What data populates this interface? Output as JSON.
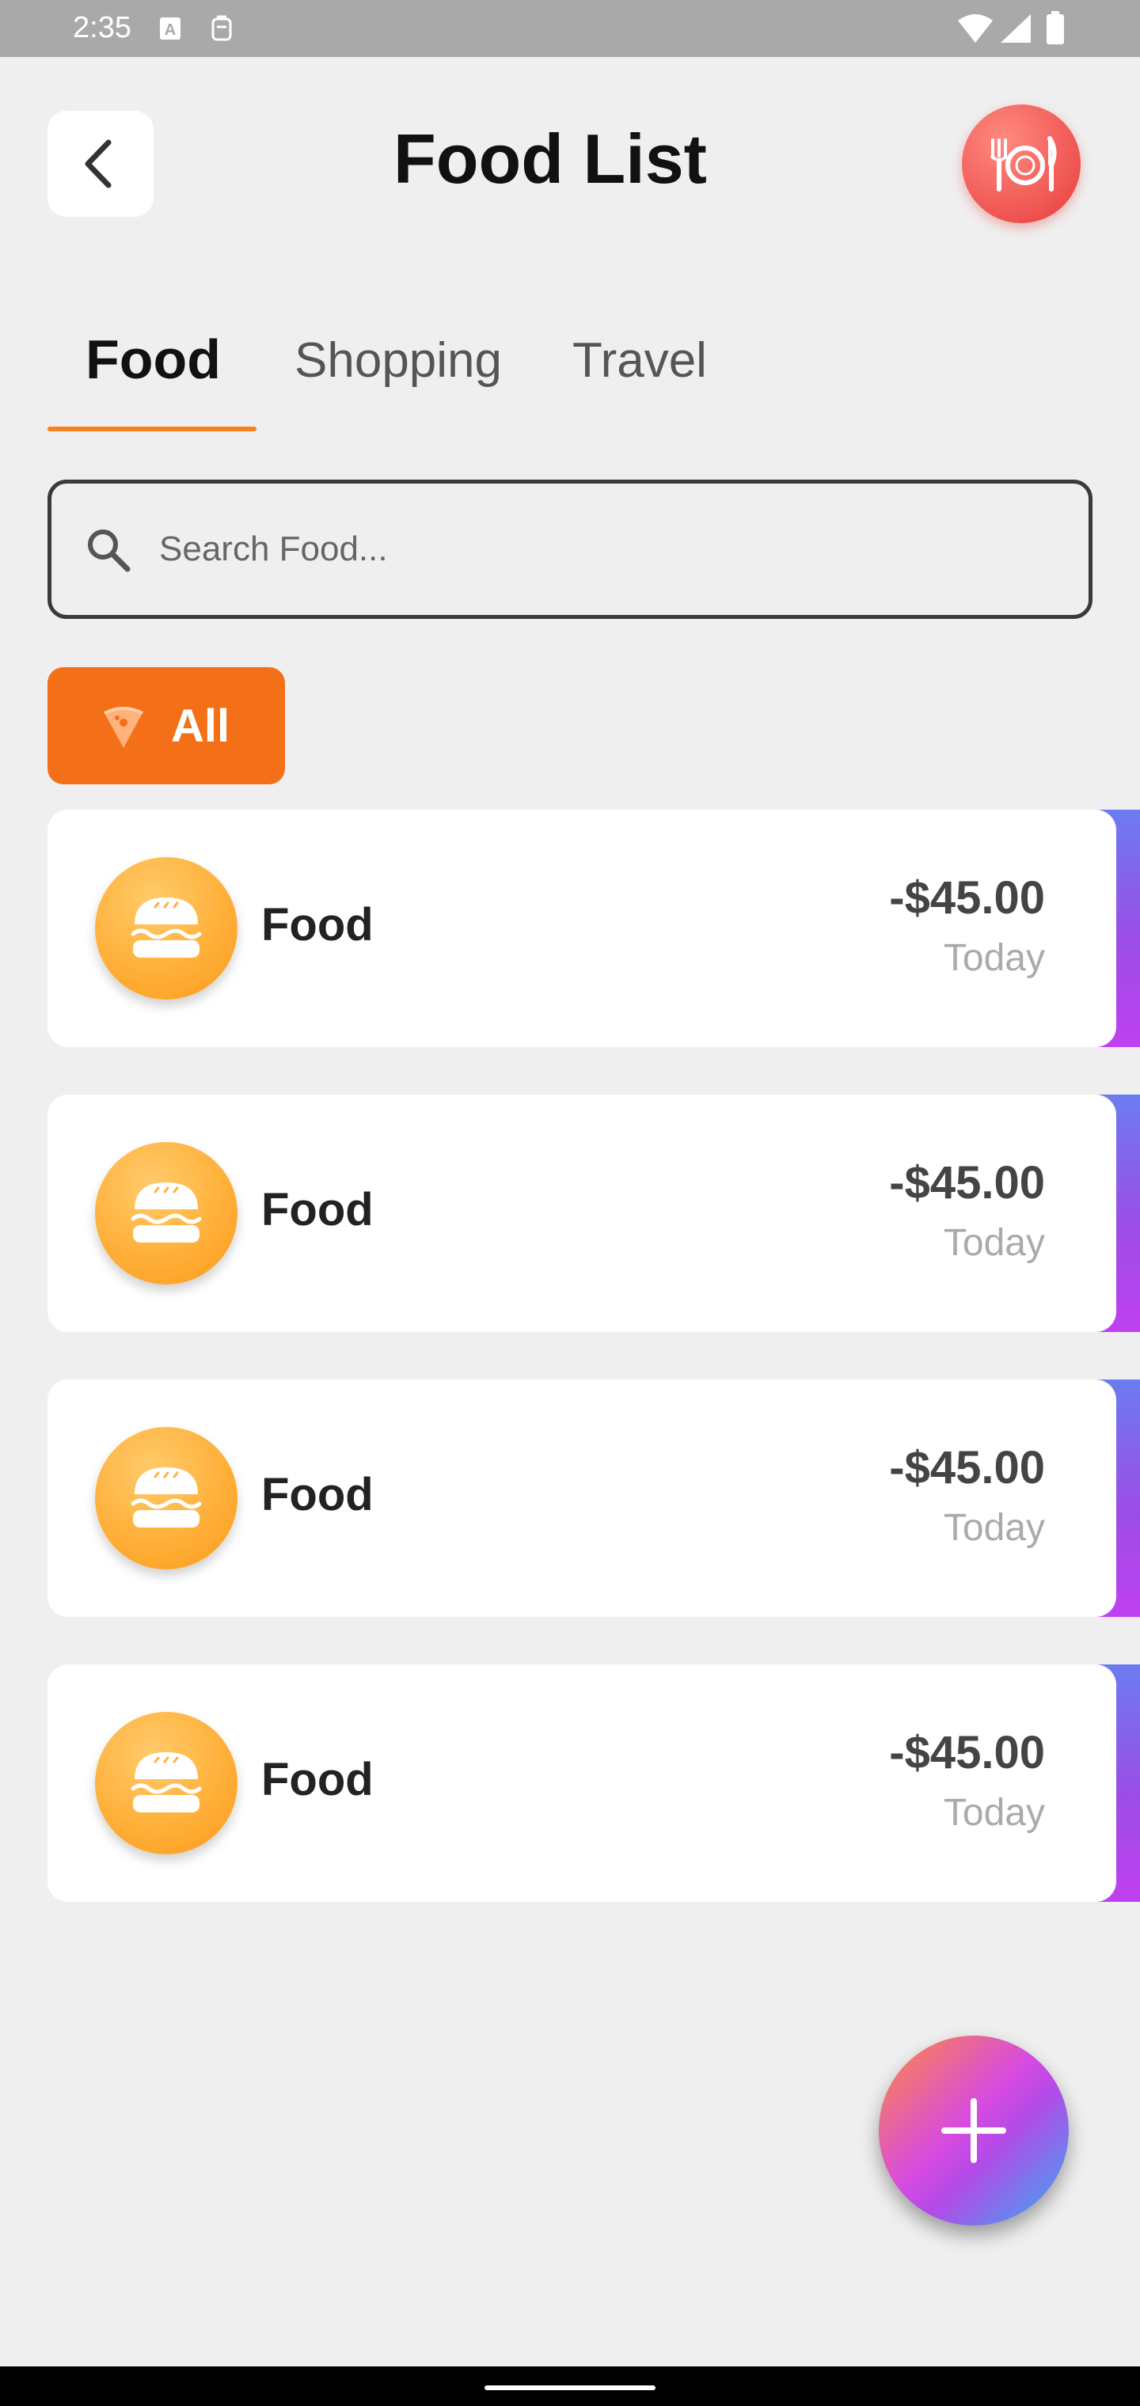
{
  "status_bar": {
    "time": "2:35"
  },
  "header": {
    "title": "Food List"
  },
  "tabs": [
    {
      "label": "Food",
      "active": true
    },
    {
      "label": "Shopping",
      "active": false
    },
    {
      "label": "Travel",
      "active": false
    }
  ],
  "search": {
    "placeholder": "Search Food...",
    "value": ""
  },
  "filter": {
    "label": "All"
  },
  "items": [
    {
      "title": "Food",
      "amount": "-$45.00",
      "date": "Today",
      "icon": "burger-icon"
    },
    {
      "title": "Food",
      "amount": "-$45.00",
      "date": "Today",
      "icon": "burger-icon"
    },
    {
      "title": "Food",
      "amount": "-$45.00",
      "date": "Today",
      "icon": "burger-icon"
    },
    {
      "title": "Food",
      "amount": "-$45.00",
      "date": "Today",
      "icon": "burger-icon"
    }
  ],
  "colors": {
    "accent_orange": "#f37018",
    "tab_underline": "#f58220",
    "badge_red": "#ef5350",
    "card_icon_orange": "#ffb03a",
    "background": "#efefef"
  }
}
